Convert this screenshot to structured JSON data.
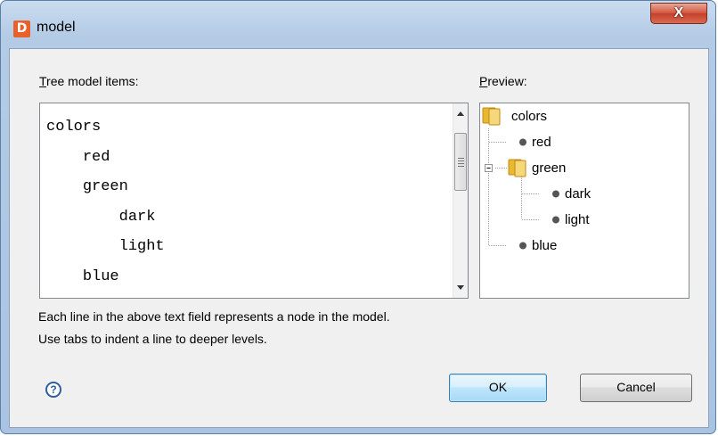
{
  "window": {
    "title": "model",
    "app_icon_glyph": "D"
  },
  "titlebar": {
    "close_glyph": "X"
  },
  "editor": {
    "label_accel": "T",
    "label_rest": "ree model items:",
    "text": "colors\n\tred\n\tgreen\n\t\tdark\n\t\tlight\n\tblue"
  },
  "preview": {
    "label_accel": "P",
    "label_rest": "review:",
    "nodes": [
      "colors",
      "red",
      "green",
      "dark",
      "light",
      "blue"
    ]
  },
  "help": {
    "line1": "Each line in the above text field represents a node in the model.",
    "line2": "Use tabs to indent a line to deeper levels.",
    "icon_glyph": "?"
  },
  "buttons": {
    "ok": "OK",
    "cancel": "Cancel"
  },
  "colors": {
    "folder": "#e8b830",
    "accent": "#3c7fb1"
  },
  "icons": {
    "app": "app-icon",
    "close": "close-icon",
    "help": "help-icon",
    "folder": "folder-icon",
    "leaf": "leaf-icon",
    "collapse": "collapse-icon"
  }
}
